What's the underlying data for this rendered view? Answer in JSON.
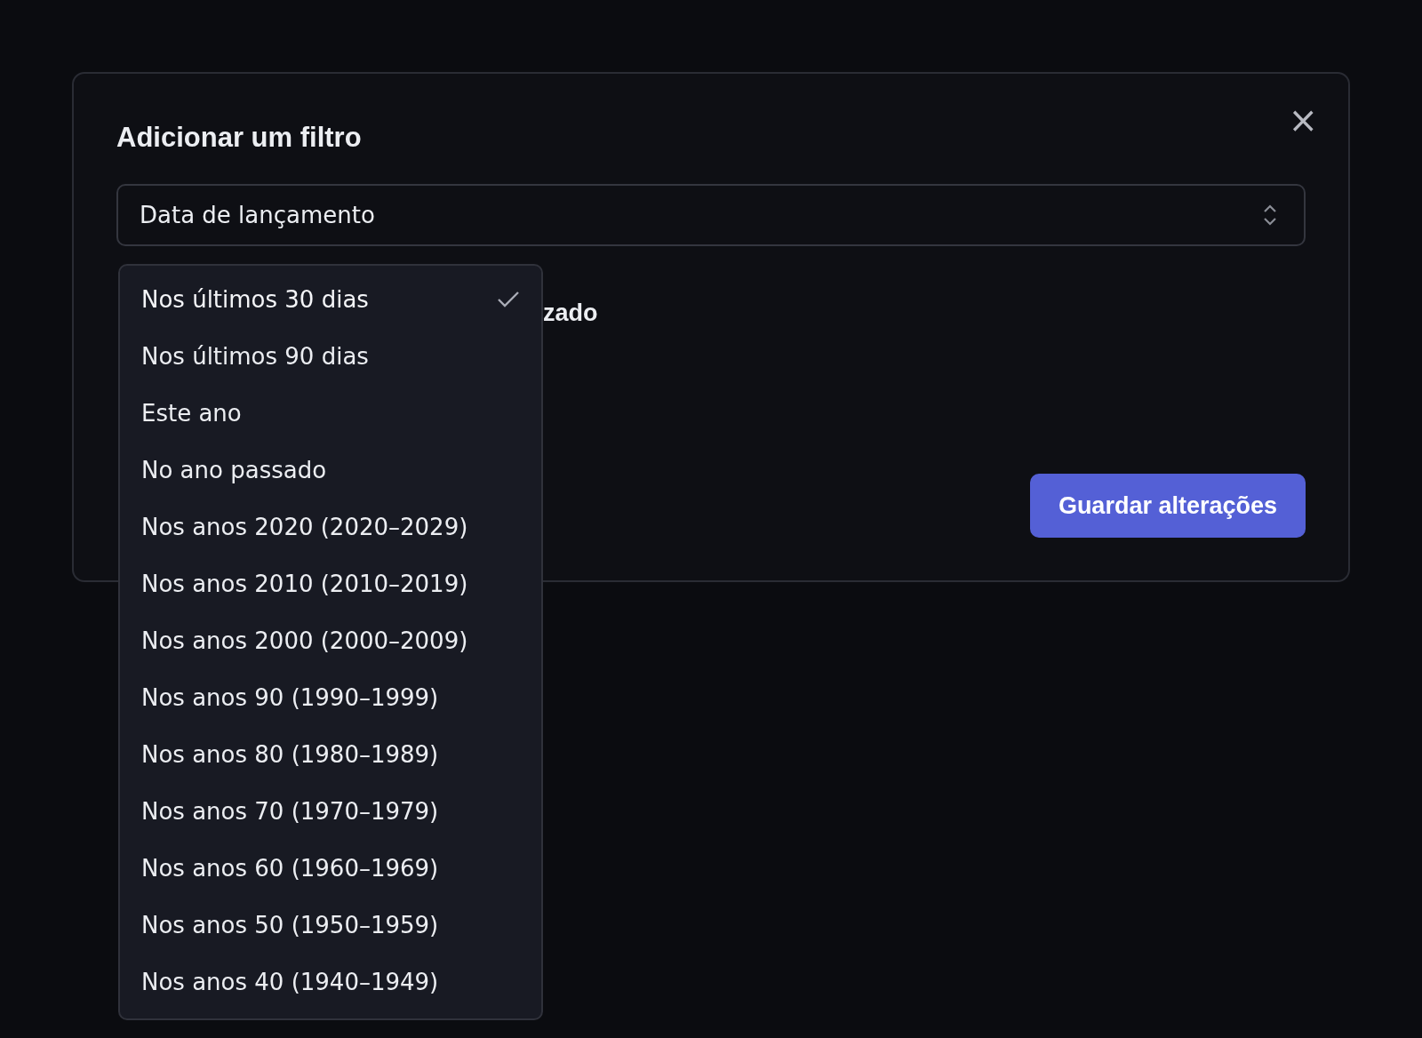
{
  "dialog": {
    "title": "Adicionar um filtro",
    "close": "×",
    "select": {
      "value": "Data de lançamento"
    },
    "partial_label": "zado",
    "save_button": "Guardar alterações"
  },
  "dropdown": {
    "options": [
      {
        "label": "Nos últimos 30 dias",
        "selected": true
      },
      {
        "label": "Nos últimos 90 dias",
        "selected": false
      },
      {
        "label": "Este ano",
        "selected": false
      },
      {
        "label": "No ano passado",
        "selected": false
      },
      {
        "label": "Nos anos 2020 (2020–2029)",
        "selected": false
      },
      {
        "label": "Nos anos 2010 (2010–2019)",
        "selected": false
      },
      {
        "label": "Nos anos 2000 (2000–2009)",
        "selected": false
      },
      {
        "label": "Nos anos 90 (1990–1999)",
        "selected": false
      },
      {
        "label": "Nos anos 80 (1980–1989)",
        "selected": false
      },
      {
        "label": "Nos anos 70 (1970–1979)",
        "selected": false
      },
      {
        "label": "Nos anos 60 (1960–1969)",
        "selected": false
      },
      {
        "label": "Nos anos 50 (1950–1959)",
        "selected": false
      },
      {
        "label": "Nos anos 40 (1940–1949)",
        "selected": false
      }
    ]
  }
}
